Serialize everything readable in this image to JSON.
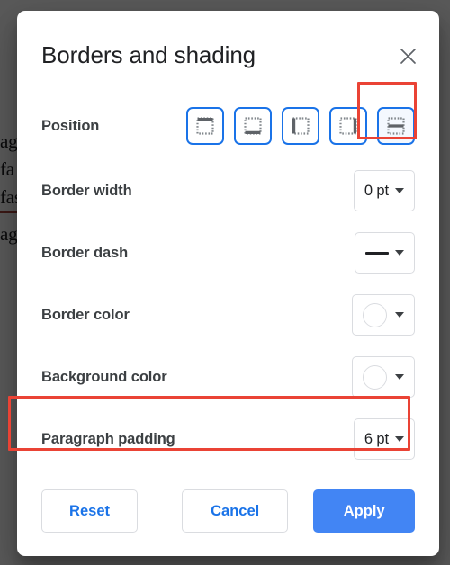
{
  "background": {
    "doc_fragments": [
      "ag",
      "fa",
      "fas",
      "ag"
    ],
    "scrim_color": "#000000"
  },
  "dialog": {
    "title": "Borders and shading",
    "close_icon": "close-icon",
    "rows": {
      "position": {
        "label": "Position",
        "options": [
          {
            "name": "top-border",
            "selected": false
          },
          {
            "name": "bottom-border",
            "selected": false
          },
          {
            "name": "left-border",
            "selected": false
          },
          {
            "name": "right-border",
            "selected": false
          },
          {
            "name": "between-border",
            "selected": true
          }
        ]
      },
      "border_width": {
        "label": "Border width",
        "value": "0 pt",
        "control": "dropdown"
      },
      "border_dash": {
        "label": "Border dash",
        "value": "solid-line",
        "control": "dropdown"
      },
      "border_color": {
        "label": "Border color",
        "value": "",
        "swatch_color": "#ffffff",
        "control": "color-dropdown"
      },
      "background_color": {
        "label": "Background color",
        "value": "",
        "swatch_color": "#ffffff",
        "control": "color-dropdown"
      },
      "paragraph_padding": {
        "label": "Paragraph padding",
        "value": "6 pt",
        "control": "dropdown"
      }
    },
    "footer": {
      "reset_label": "Reset",
      "cancel_label": "Cancel",
      "apply_label": "Apply"
    }
  },
  "annotations": {
    "highlight_color": "#ea4335",
    "targets": [
      "position-option-between-border",
      "row-paragraph-padding"
    ]
  },
  "theme": {
    "accent": "#1a73e8",
    "primary_button": "#4285f4",
    "text": "#202124",
    "label_text": "#3c4043",
    "border": "#dadce0"
  }
}
